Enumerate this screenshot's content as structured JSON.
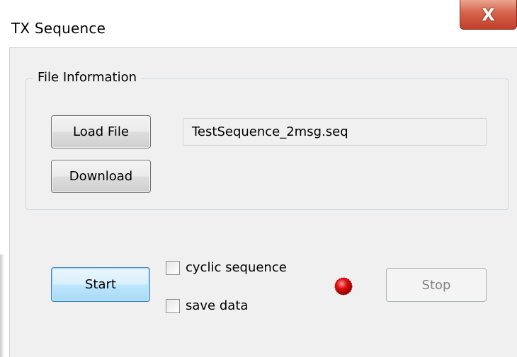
{
  "window": {
    "title": "TX Sequence",
    "close_symbol": "X"
  },
  "file_information": {
    "group_label": "File Information",
    "load_file_label": "Load File",
    "download_label": "Download",
    "file_name": "TestSequence_2msg.seq"
  },
  "controls": {
    "start_label": "Start",
    "stop_label": "Stop",
    "cyclic_sequence_label": "cyclic sequence",
    "cyclic_sequence_checked": false,
    "save_data_label": "save data",
    "save_data_checked": false,
    "status_led_color": "#e01010"
  }
}
